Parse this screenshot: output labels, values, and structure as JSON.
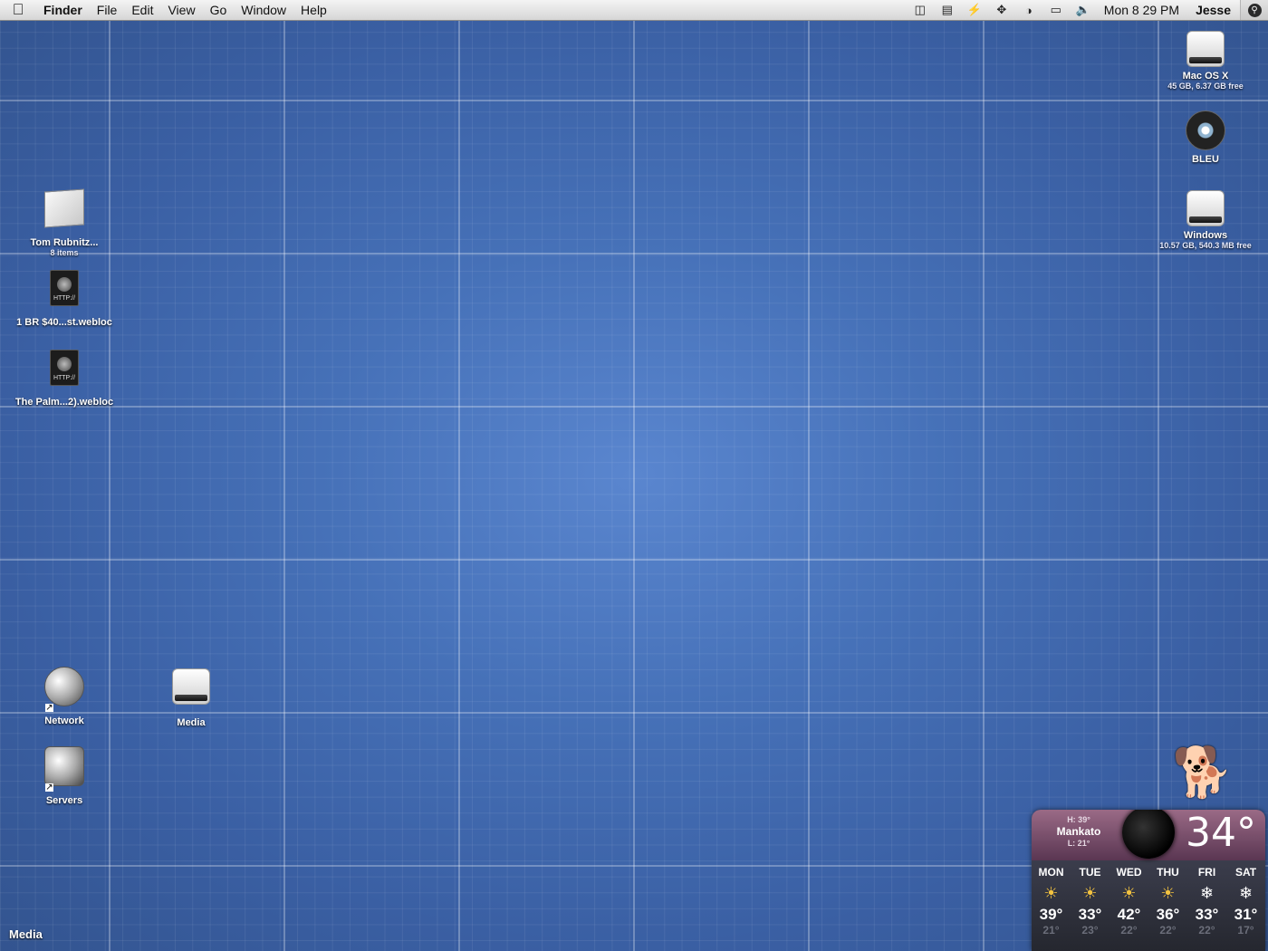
{
  "menubar": {
    "apple_icon": "apple-icon",
    "app_name": "Finder",
    "menus": [
      "File",
      "Edit",
      "View",
      "Go",
      "Window",
      "Help"
    ],
    "status_icons": [
      "screens-icon",
      "battery-icon",
      "bolt-icon",
      "bluetooth-icon",
      "wifi-icon",
      "power-icon",
      "volume-icon"
    ],
    "clock": "Mon 8 29 PM",
    "user": "Jesse",
    "spotlight_icon": "search-icon"
  },
  "desktop_right": [
    {
      "name": "Mac OS X",
      "sub": "45 GB, 6.37 GB free",
      "icon": "hard-drive-icon"
    },
    {
      "name": "BLEU",
      "sub": "",
      "icon": "cd-icon"
    },
    {
      "name": "Windows",
      "sub": "10.57 GB, 540.3 MB free",
      "icon": "hard-drive-icon"
    }
  ],
  "desktop_left": [
    {
      "name": "Tom Rubnitz...",
      "sub": "8 items",
      "icon": "folder-icon"
    },
    {
      "name": "1 BR $40...st.webloc",
      "icon": "webloc-icon",
      "badge": "HTTP://"
    },
    {
      "name": "The Palm...2).webloc",
      "icon": "webloc-icon",
      "badge": "HTTP://"
    }
  ],
  "desktop_bottom": [
    {
      "name": "Network",
      "icon": "network-globe-icon"
    },
    {
      "name": "Media",
      "icon": "hard-drive-icon"
    },
    {
      "name": "Servers",
      "icon": "server-icon"
    }
  ],
  "bottom_label": "Media",
  "weather": {
    "city": "Mankato",
    "high": "H: 39°",
    "low": "L: 21°",
    "current_temp": "34°",
    "days": [
      {
        "day": "MON",
        "hi": "39°",
        "lo": "21°",
        "icon": "sun-icon"
      },
      {
        "day": "TUE",
        "hi": "33°",
        "lo": "23°",
        "icon": "sun-icon"
      },
      {
        "day": "WED",
        "hi": "42°",
        "lo": "22°",
        "icon": "sun-icon"
      },
      {
        "day": "THU",
        "hi": "36°",
        "lo": "22°",
        "icon": "sun-icon"
      },
      {
        "day": "FRI",
        "hi": "33°",
        "lo": "22°",
        "icon": "snow-cloud-icon"
      },
      {
        "day": "SAT",
        "hi": "31°",
        "lo": "17°",
        "icon": "snow-cloud-icon"
      }
    ]
  }
}
